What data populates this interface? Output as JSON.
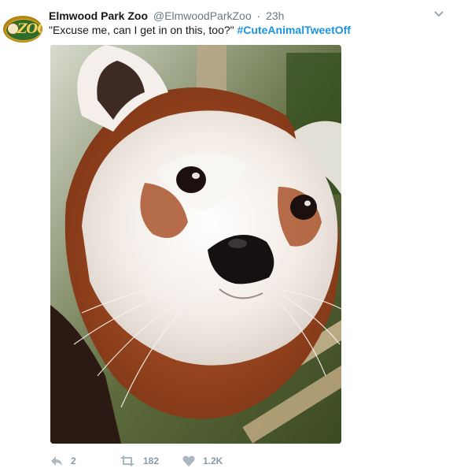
{
  "tweet": {
    "author_name": "Elmwood Park Zoo",
    "author_handle": "@ElmwoodParkZoo",
    "separator": "·",
    "timestamp": "23h",
    "text": "\"Excuse me, can I get in on this, too?\"",
    "hashtag": "#CuteAnimalTweetOff",
    "avatar_logo_text": "ZOO",
    "media_icon": "red-panda-photo",
    "caret_icon": "chevron-down-icon",
    "actions": {
      "reply_count": "2",
      "retweet_count": "182",
      "like_count": "1.2K"
    },
    "colors": {
      "link": "#1b95e0",
      "muted": "#657786",
      "action": "#8899a6"
    }
  }
}
